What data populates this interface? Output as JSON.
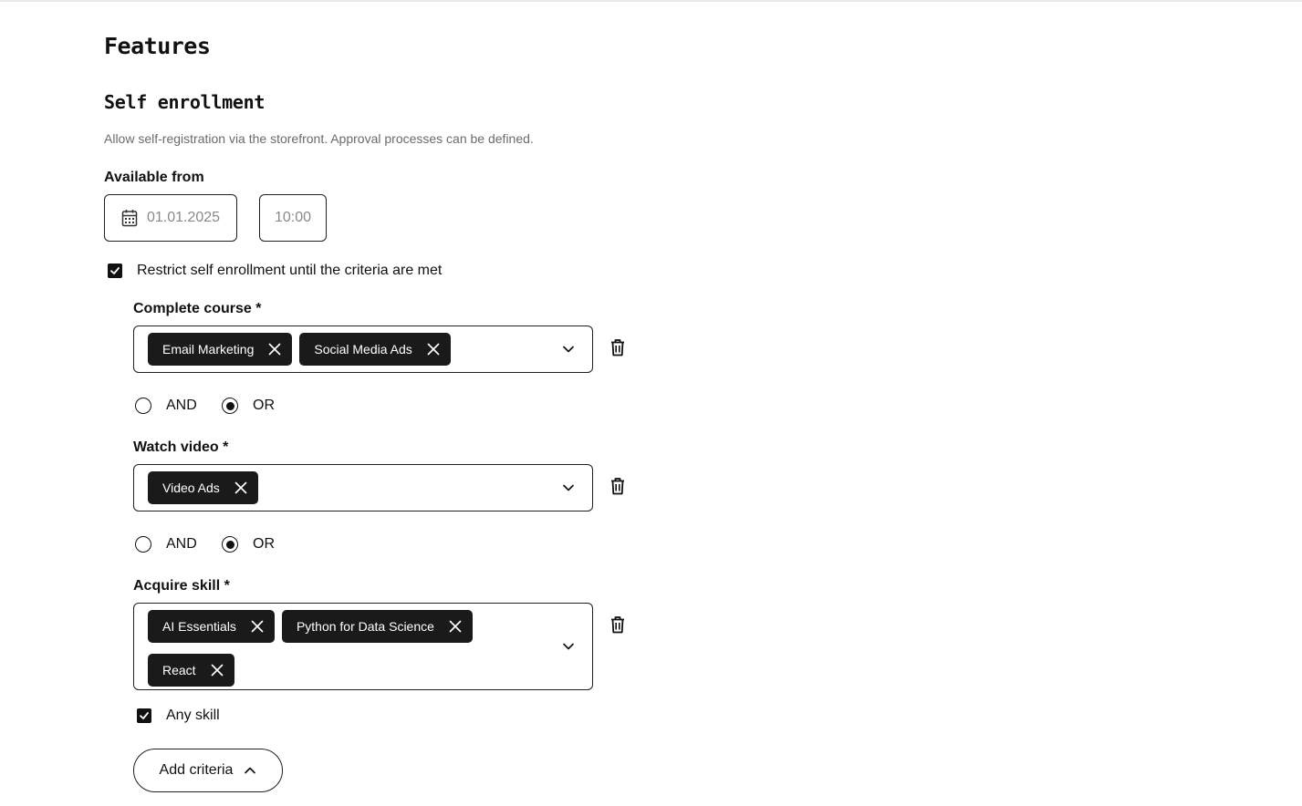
{
  "page": {
    "title": "Features"
  },
  "section": {
    "title": "Self enrollment",
    "description": "Allow self-registration via the storefront. Approval processes can be defined."
  },
  "available_from": {
    "label": "Available from",
    "date": "01.01.2025",
    "time": "10:00"
  },
  "restrict": {
    "label": "Restrict self enrollment until the criteria are met",
    "checked": true
  },
  "criteria": [
    {
      "label": "Complete course *",
      "chips": [
        "Email Marketing",
        "Social Media Ads"
      ],
      "operator": {
        "options": [
          "AND",
          "OR"
        ],
        "selected": "OR"
      }
    },
    {
      "label": "Watch video *",
      "chips": [
        "Video Ads"
      ],
      "operator": {
        "options": [
          "AND",
          "OR"
        ],
        "selected": "OR"
      }
    },
    {
      "label": "Acquire skill *",
      "chips": [
        "AI Essentials",
        "Python for Data Science",
        "React"
      ],
      "any_skill": {
        "label": "Any skill",
        "checked": true
      }
    }
  ],
  "add_criteria": {
    "label": "Add criteria"
  },
  "icons": {
    "calendar": "calendar-icon",
    "remove": "close-icon",
    "dropdown": "chevron-down-icon",
    "delete": "trash-icon",
    "collapse": "chevron-up-icon",
    "check": "checkmark-icon"
  }
}
